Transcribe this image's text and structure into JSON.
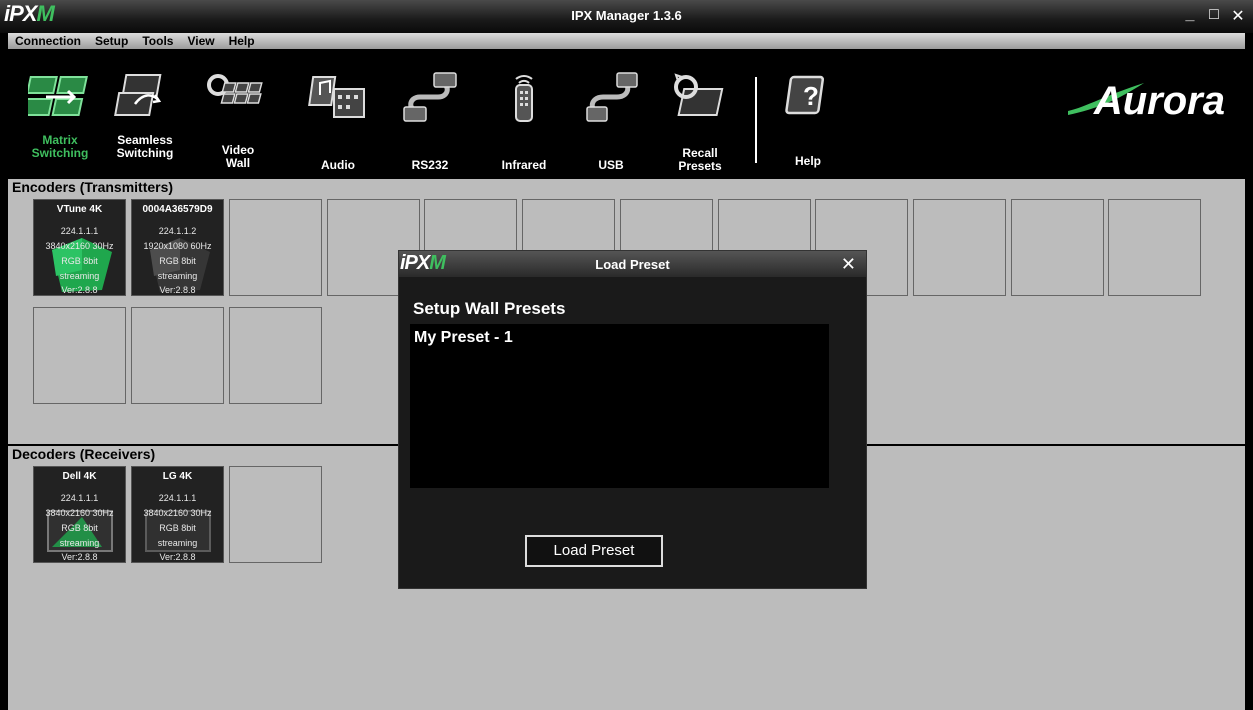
{
  "window": {
    "logo_ip": "iPX",
    "logo_m": "M",
    "title": "IPX Manager 1.3.6",
    "minimize": "_",
    "maximize": "□",
    "close": "✕"
  },
  "menu": [
    "Connection",
    "Setup",
    "Tools",
    "View",
    "Help"
  ],
  "toolbar": {
    "tools": [
      {
        "label": "Matrix\nSwitching",
        "icon": "matrix-switching-icon",
        "active": true
      },
      {
        "label": "Seamless\nSwitching",
        "icon": "seamless-switching-icon"
      },
      {
        "label": "Video\nWall",
        "icon": "video-wall-icon"
      },
      {
        "label": "Audio",
        "icon": "audio-icon"
      },
      {
        "label": "RS232",
        "icon": "rs232-icon"
      },
      {
        "label": "Infrared",
        "icon": "infrared-icon"
      },
      {
        "label": "USB",
        "icon": "usb-icon"
      },
      {
        "label": "Recall\nPresets",
        "icon": "recall-presets-icon"
      },
      {
        "label": "Help",
        "icon": "help-icon"
      }
    ],
    "brand": "Aurora",
    "accent": "#3fbf5f"
  },
  "encoders": {
    "title": "Encoders (Transmitters)",
    "devices": [
      {
        "name": "VTune 4K",
        "ip": "224.1.1.1",
        "res": "3840x2160 30Hz",
        "color": "RGB 8bit",
        "status": "streaming",
        "ver": "Ver:2.8.8"
      },
      {
        "name": "0004A36579D9",
        "ip": "224.1.1.2",
        "res": "1920x1080 60Hz",
        "color": "RGB 8bit",
        "status": "streaming",
        "ver": "Ver:2.8.8"
      }
    ]
  },
  "decoders": {
    "title": "Decoders (Receivers)",
    "devices": [
      {
        "name": "Dell 4K",
        "ip": "224.1.1.1",
        "res": "3840x2160 30Hz",
        "color": "RGB 8bit",
        "status": "streaming",
        "ver": "Ver:2.8.8"
      },
      {
        "name": "LG 4K",
        "ip": "224.1.1.1",
        "res": "3840x2160 30Hz",
        "color": "RGB 8bit",
        "status": "streaming",
        "ver": "Ver:2.8.8"
      }
    ]
  },
  "dialog": {
    "logo_ip": "iPX",
    "logo_m": "M",
    "title": "Load Preset",
    "close": "✕",
    "heading": "Setup Wall Presets",
    "presets": [
      "My Preset  -  1"
    ],
    "button": "Load Preset"
  }
}
